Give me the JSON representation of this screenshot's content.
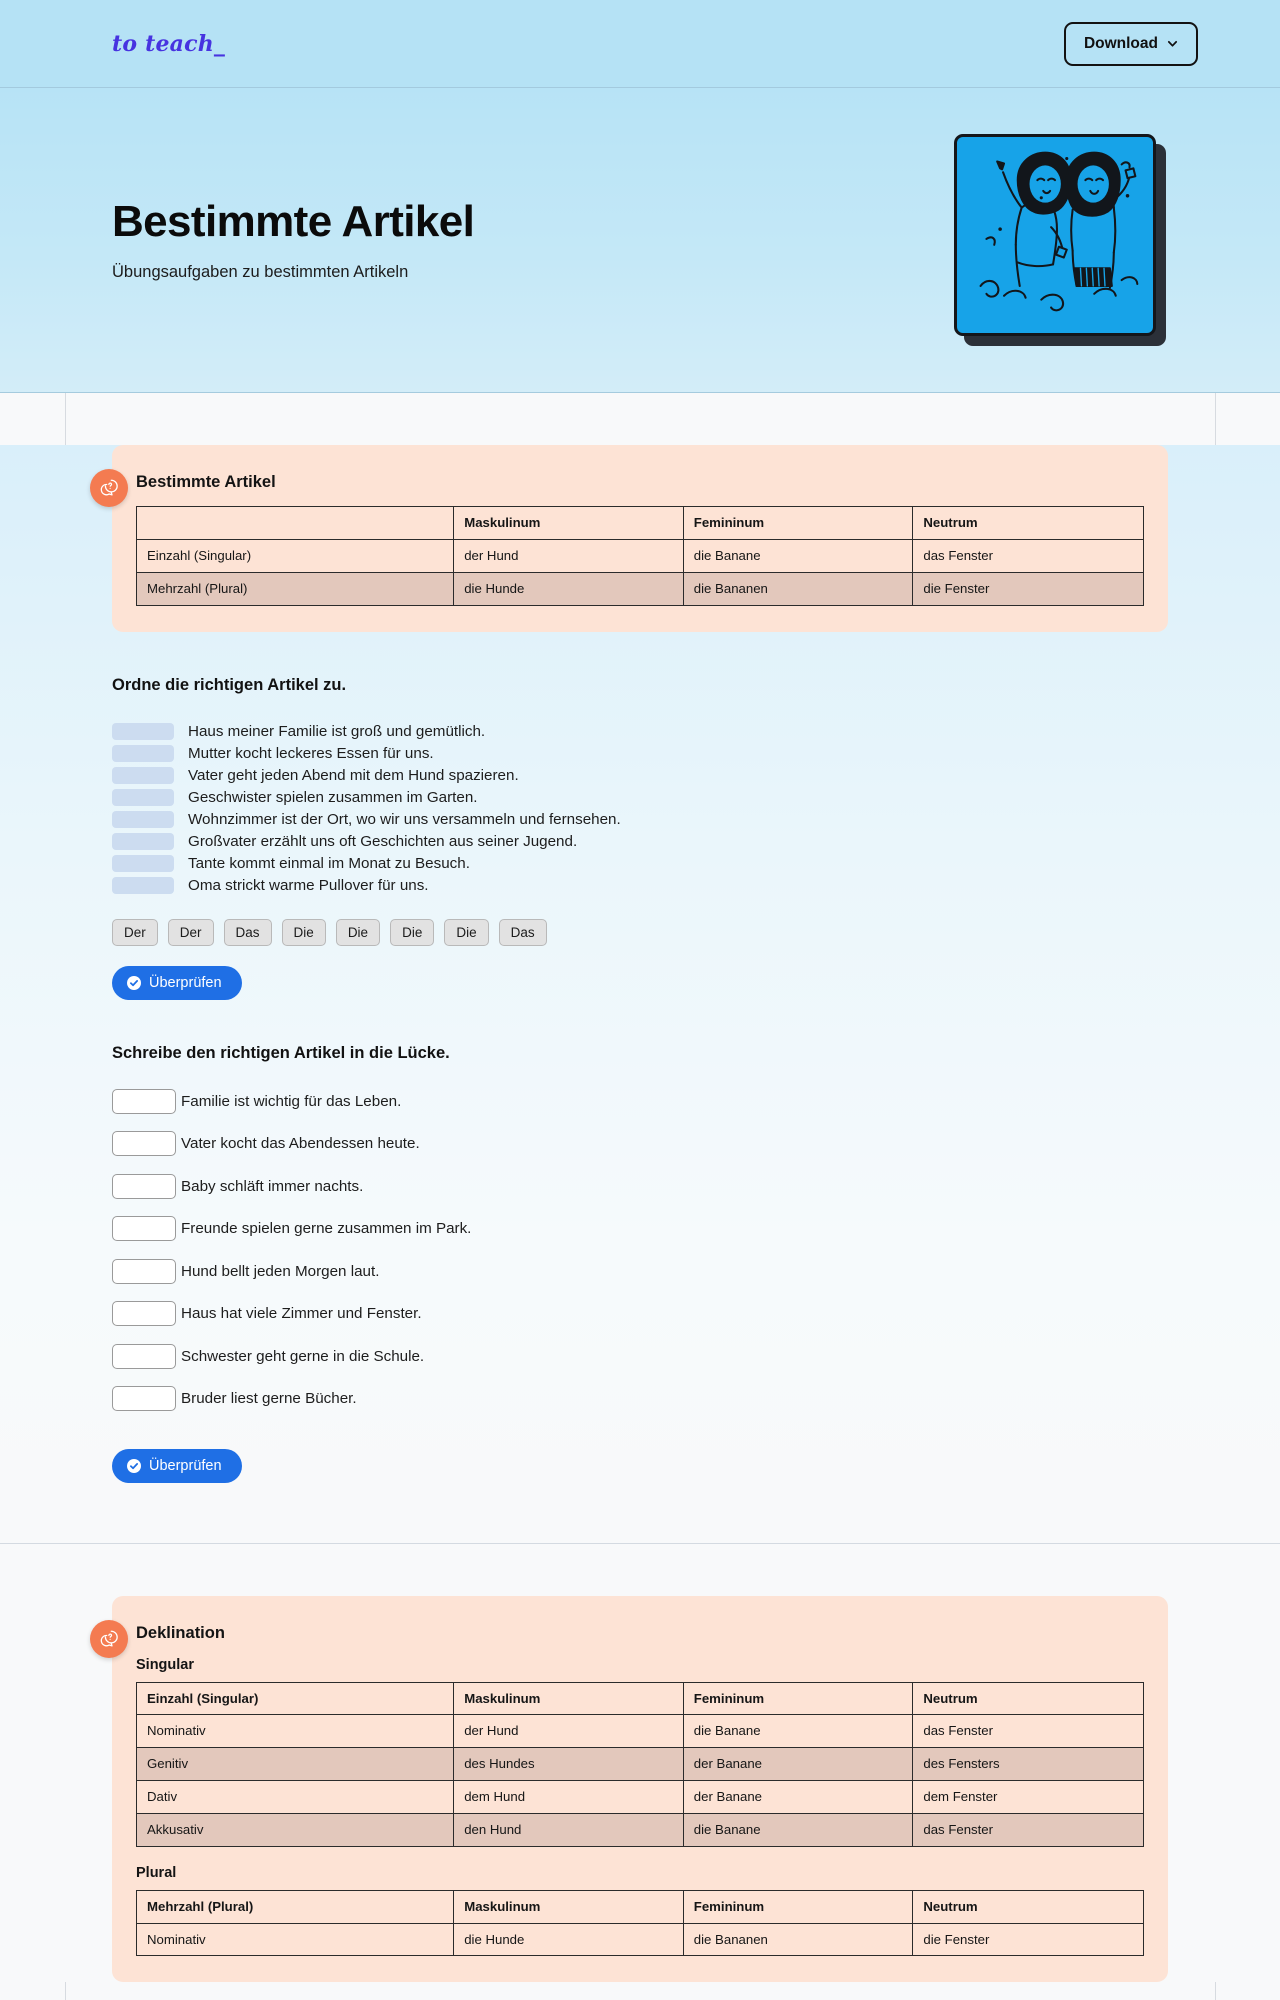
{
  "header": {
    "logo": "to teach_",
    "download_label": "Download",
    "chevron_icon": "chevron-down-icon"
  },
  "hero": {
    "title": "Bestimmte Artikel",
    "subtitle": "Übungsaufgaben zu bestimmten Artikeln",
    "cover_illustration": "two-figures-celebrating-illustration"
  },
  "info_card": {
    "badge_icon": "question-speech-bubble-icon",
    "title": "Bestimmte Artikel",
    "table": {
      "headers": [
        "",
        "Maskulinum",
        "Femininum",
        "Neutrum"
      ],
      "rows": [
        [
          "Einzahl (Singular)",
          "der Hund",
          "die Banane",
          "das Fenster"
        ],
        [
          "Mehrzahl (Plural)",
          "die Hunde",
          "die Bananen",
          "die Fenster"
        ]
      ]
    }
  },
  "exercise_drag": {
    "title": "Ordne die richtigen Artikel zu.",
    "sentences": [
      "Haus meiner Familie ist groß und gemütlich.",
      "Mutter kocht leckeres Essen für uns.",
      "Vater geht jeden Abend mit dem Hund spazieren.",
      "Geschwister spielen zusammen im Garten.",
      "Wohnzimmer ist der Ort, wo wir uns versammeln und fernsehen.",
      "Großvater erzählt uns oft Geschichten aus seiner Jugend.",
      "Tante kommt einmal im Monat zu Besuch.",
      "Oma strickt warme Pullover für uns."
    ],
    "chips": [
      "Der",
      "Der",
      "Das",
      "Die",
      "Die",
      "Die",
      "Die",
      "Das"
    ],
    "check_label": "Überprüfen",
    "check_icon": "check-circle-icon"
  },
  "exercise_fill": {
    "title": "Schreibe den richtigen Artikel in die Lücke.",
    "placeholder": "",
    "sentences": [
      "Familie ist wichtig für das Leben.",
      "Vater kocht das Abendessen heute.",
      "Baby schläft immer nachts.",
      "Freunde spielen gerne zusammen im Park.",
      "Hund bellt jeden Morgen laut.",
      "Haus hat viele Zimmer und Fenster.",
      "Schwester geht gerne in die Schule.",
      "Bruder liest gerne Bücher."
    ],
    "values": [
      "",
      "",
      "",
      "",
      "",
      "",
      "",
      ""
    ],
    "check_label": "Überprüfen",
    "check_icon": "check-circle-icon"
  },
  "declination_card": {
    "badge_icon": "question-speech-bubble-icon",
    "title": "Deklination",
    "singular_label": "Singular",
    "singular_table": {
      "headers": [
        "Einzahl (Singular)",
        "Maskulinum",
        "Femininum",
        "Neutrum"
      ],
      "rows": [
        [
          "Nominativ",
          "der Hund",
          "die Banane",
          "das Fenster"
        ],
        [
          "Genitiv",
          "des Hundes",
          "der Banane",
          "des Fensters"
        ],
        [
          "Dativ",
          "dem Hund",
          "der Banane",
          "dem Fenster"
        ],
        [
          "Akkusativ",
          "den Hund",
          "die Banane",
          "das Fenster"
        ]
      ]
    },
    "plural_label": "Plural",
    "plural_table": {
      "headers": [
        "Mehrzahl (Plural)",
        "Maskulinum",
        "Femininum",
        "Neutrum"
      ],
      "rows": [
        [
          "Nominativ",
          "die Hunde",
          "die Bananen",
          "die Fenster"
        ]
      ]
    }
  },
  "colors": {
    "header_bg": "#b5e2f5",
    "logo": "#4733e0",
    "info_card_bg": "#fde3d5",
    "badge": "#f47b51",
    "table_alt_row": "#e3c8bc",
    "slot": "#ccdcf0",
    "chip": "#e2e2e2",
    "button": "#1f6fe5",
    "cover": "#17a3e8"
  }
}
